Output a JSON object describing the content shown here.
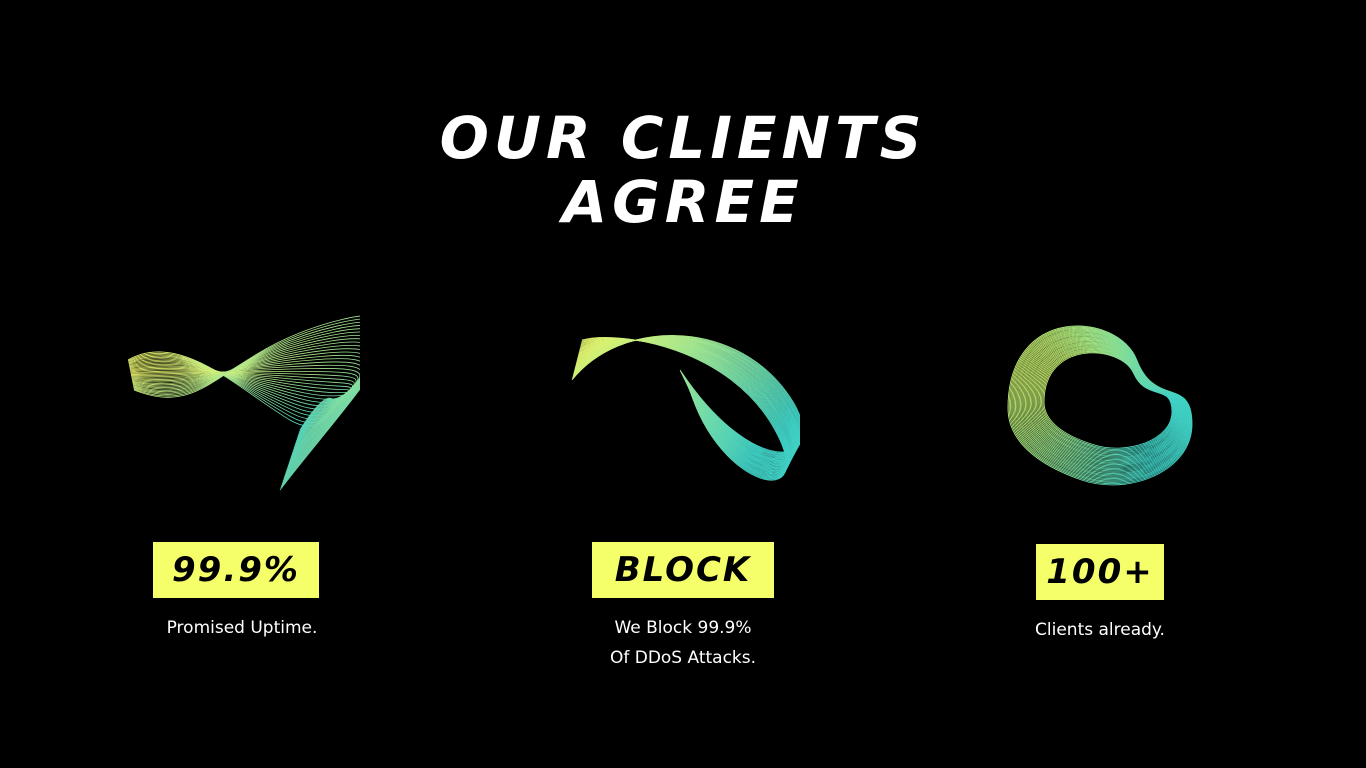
{
  "headline": {
    "line1": "OUR CLIENTS",
    "line2": "AGREE"
  },
  "stats": [
    {
      "value": "99.9%",
      "caption_lines": [
        "Promised Uptime."
      ],
      "illustration": "twisted-ribbon-wireframe"
    },
    {
      "value": "BLOCK",
      "caption_lines": [
        "We Block 99.9%",
        "Of DDoS Attacks."
      ],
      "illustration": "folded-shell-wireframe"
    },
    {
      "value": "100+",
      "caption_lines": [
        "Clients already."
      ],
      "illustration": "ring-torus-wireframe"
    }
  ],
  "colors": {
    "background": "#000000",
    "text": "#ffffff",
    "badge": "#f4ff6a",
    "gradient_start": "#e8f56a",
    "gradient_end": "#3fd0c4"
  }
}
